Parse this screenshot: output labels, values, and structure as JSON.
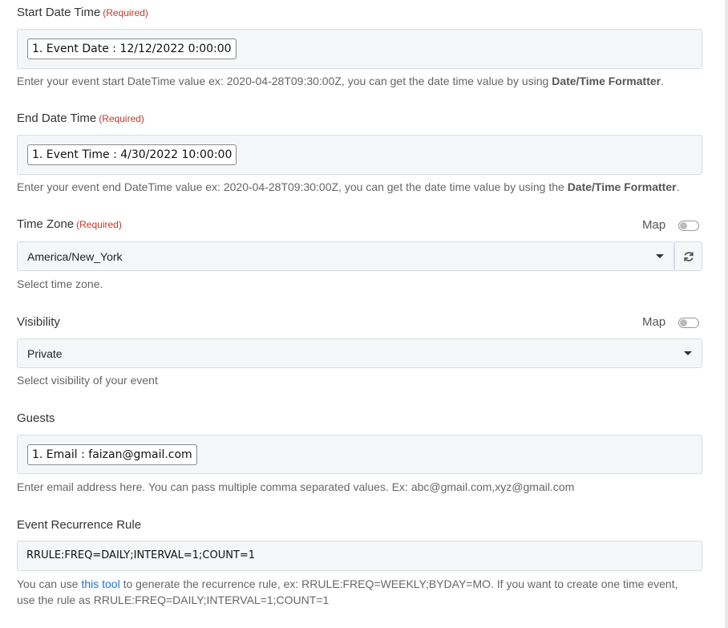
{
  "required_tag": "(Required)",
  "start_date": {
    "label": "Start Date Time",
    "chip": "1. Event Date : 12/12/2022 0:00:00",
    "help_prefix": "Enter your event start DateTime value ex: 2020-04-28T09:30:00Z, you can get the date time value by using ",
    "help_link": "Date/Time Formatter",
    "help_suffix": "."
  },
  "end_date": {
    "label": "End Date Time",
    "chip": "1. Event Time : 4/30/2022 10:00:00",
    "help_prefix": "Enter your event end DateTime value ex: 2020-04-28T09:30:00Z, you can get the date time value by using the ",
    "help_link": "Date/Time Formatter",
    "help_suffix": "."
  },
  "time_zone": {
    "label": "Time Zone",
    "map_label": "Map",
    "selected": "America/New_York",
    "help": "Select time zone."
  },
  "visibility": {
    "label": "Visibility",
    "map_label": "Map",
    "selected": "Private",
    "help": "Select visibility of your event"
  },
  "guests": {
    "label": "Guests",
    "chip": "1. Email : faizan@gmail.com",
    "help": "Enter email address here. You can pass multiple comma separated values. Ex: abc@gmail.com,xyz@gmail.com"
  },
  "recurrence": {
    "label": "Event Recurrence Rule",
    "value": "RRULE:FREQ=DAILY;INTERVAL=1;COUNT=1",
    "help_prefix": "You can use ",
    "help_link": "this tool",
    "help_line1_suffix": " to generate the recurrence rule, ex: RRULE:FREQ=WEEKLY;BYDAY=MO. If you want to create one time event,",
    "help_line2": "use the rule as RRULE:FREQ=DAILY;INTERVAL=1;COUNT=1"
  },
  "icons": {
    "refresh": "refresh-icon",
    "dropdown": "chevron-down-icon"
  }
}
